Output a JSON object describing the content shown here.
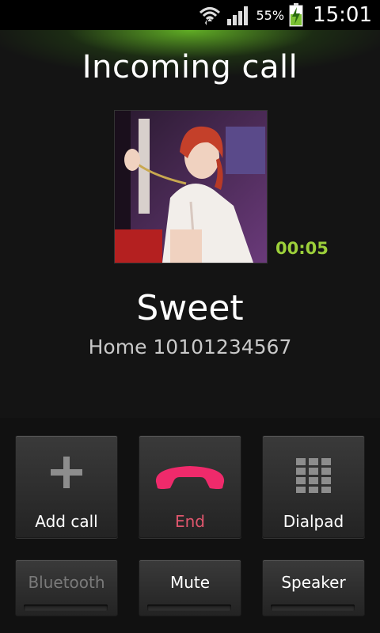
{
  "status_bar": {
    "battery_percent": "55%",
    "time": "15:01",
    "icons": [
      "wifi-icon",
      "signal-icon",
      "battery-charging-icon"
    ]
  },
  "call": {
    "title": "Incoming call",
    "timer": "00:05",
    "contact_name": "Sweet",
    "contact_number": "Home 10101234567"
  },
  "actions": {
    "add_call": {
      "label": "Add call",
      "icon": "plus-icon"
    },
    "end": {
      "label": "End",
      "icon": "phone-hangup-icon"
    },
    "dialpad": {
      "label": "Dialpad",
      "icon": "dialpad-icon"
    }
  },
  "toggles": {
    "bluetooth": {
      "label": "Bluetooth",
      "enabled": false
    },
    "mute": {
      "label": "Mute",
      "enabled": true
    },
    "speaker": {
      "label": "Speaker",
      "enabled": true
    }
  },
  "colors": {
    "accent_green": "#9ccf3a",
    "end_red": "#e0566d",
    "hangup_pink": "#ef2a6b"
  }
}
